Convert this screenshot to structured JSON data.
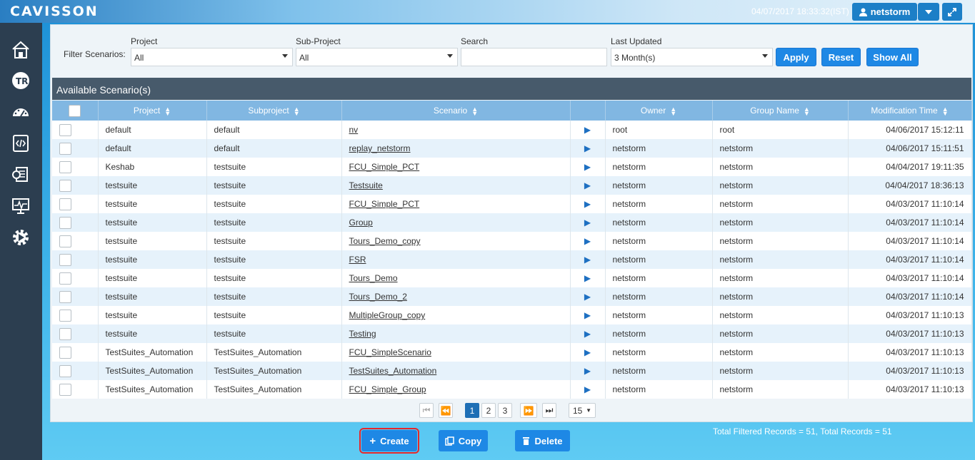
{
  "app": {
    "logo": "CAVISSON",
    "datetime": "04/07/2017 18:33:32(IST)",
    "user": "netstorm"
  },
  "sidebar": {
    "items": [
      "home-icon",
      "test-run-icon",
      "dashboard-icon",
      "scripts-icon",
      "reports-icon",
      "monitor-icon",
      "settings-icon"
    ]
  },
  "filter": {
    "label": "Filter Scenarios:",
    "project_label": "Project",
    "project_value": "All",
    "subproject_label": "Sub-Project",
    "subproject_value": "All",
    "search_label": "Search",
    "search_value": "",
    "updated_label": "Last Updated",
    "updated_value": "3 Month(s)",
    "apply": "Apply",
    "reset": "Reset",
    "show_all": "Show All"
  },
  "table": {
    "title": "Available Scenario(s)",
    "columns": [
      "Project",
      "Subproject",
      "Scenario",
      "Owner",
      "Group Name",
      "Modification Time"
    ],
    "rows": [
      [
        "default",
        "default",
        "nv",
        "root",
        "root",
        "04/06/2017 15:12:11"
      ],
      [
        "default",
        "default",
        "replay_netstorm",
        "netstorm",
        "netstorm",
        "04/06/2017 15:11:51"
      ],
      [
        "Keshab",
        "testsuite",
        "FCU_Simple_PCT",
        "netstorm",
        "netstorm",
        "04/04/2017 19:11:35"
      ],
      [
        "testsuite",
        "testsuite",
        "Testsuite",
        "netstorm",
        "netstorm",
        "04/04/2017 18:36:13"
      ],
      [
        "testsuite",
        "testsuite",
        "FCU_Simple_PCT",
        "netstorm",
        "netstorm",
        "04/03/2017 11:10:14"
      ],
      [
        "testsuite",
        "testsuite",
        "Group",
        "netstorm",
        "netstorm",
        "04/03/2017 11:10:14"
      ],
      [
        "testsuite",
        "testsuite",
        "Tours_Demo_copy",
        "netstorm",
        "netstorm",
        "04/03/2017 11:10:14"
      ],
      [
        "testsuite",
        "testsuite",
        "FSR",
        "netstorm",
        "netstorm",
        "04/03/2017 11:10:14"
      ],
      [
        "testsuite",
        "testsuite",
        "Tours_Demo",
        "netstorm",
        "netstorm",
        "04/03/2017 11:10:14"
      ],
      [
        "testsuite",
        "testsuite",
        "Tours_Demo_2",
        "netstorm",
        "netstorm",
        "04/03/2017 11:10:14"
      ],
      [
        "testsuite",
        "testsuite",
        "MultipleGroup_copy",
        "netstorm",
        "netstorm",
        "04/03/2017 11:10:13"
      ],
      [
        "testsuite",
        "testsuite",
        "Testing",
        "netstorm",
        "netstorm",
        "04/03/2017 11:10:13"
      ],
      [
        "TestSuites_Automation",
        "TestSuites_Automation",
        "FCU_SimpleScenario",
        "netstorm",
        "netstorm",
        "04/03/2017 11:10:13"
      ],
      [
        "TestSuites_Automation",
        "TestSuites_Automation",
        "TestSuites_Automation",
        "netstorm",
        "netstorm",
        "04/03/2017 11:10:13"
      ],
      [
        "TestSuites_Automation",
        "TestSuites_Automation",
        "FCU_Simple_Group",
        "netstorm",
        "netstorm",
        "04/03/2017 11:10:13"
      ]
    ]
  },
  "pager": {
    "pages": [
      "1",
      "2",
      "3"
    ],
    "current": "1",
    "page_size": "15"
  },
  "actions": {
    "create": "Create",
    "copy": "Copy",
    "delete": "Delete"
  },
  "records": "Total Filtered Records = 51, Total Records = 51"
}
